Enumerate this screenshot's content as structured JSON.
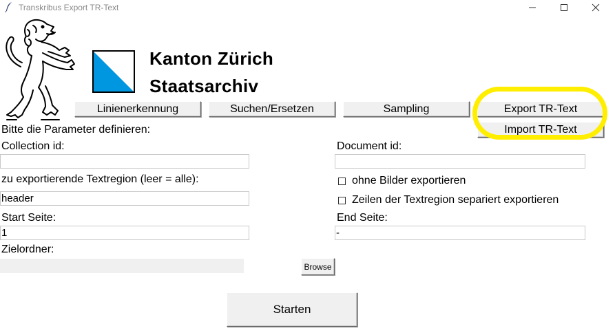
{
  "window": {
    "title": "Transkribus Export TR-Text",
    "controls": [
      "minimize-icon",
      "maximize-icon",
      "close-icon"
    ]
  },
  "header": {
    "canton": "Kanton Zürich",
    "archive": "Staatsarchiv",
    "flag_colors": {
      "blue": "#0097e0",
      "white": "#ffffff",
      "border": "#000000"
    }
  },
  "toolbar": {
    "linienerkennung": "Linienerkennung",
    "suchen": "Suchen/Ersetzen",
    "sampling": "Sampling",
    "export": "Export TR-Text",
    "import": "Import TR-Text"
  },
  "form": {
    "prompt": "Bitte die Parameter definieren:",
    "collection_label": "Collection id:",
    "collection_value": "",
    "document_label": "Document id:",
    "document_value": "",
    "textregion_label": "zu exportierende Textregion (leer = alle):",
    "textregion_value": "header",
    "ohne_bilder_label": "ohne Bilder exportieren",
    "zeilen_label": "Zeilen der Textregion separiert exportieren",
    "start_label": "Start Seite:",
    "start_value": "1",
    "end_label": "End Seite:",
    "end_value": "-",
    "ziel_label": "Zielordner:",
    "ziel_value": "",
    "browse": "Browse",
    "start_button": "Starten"
  },
  "highlight_color": "#ffee00"
}
